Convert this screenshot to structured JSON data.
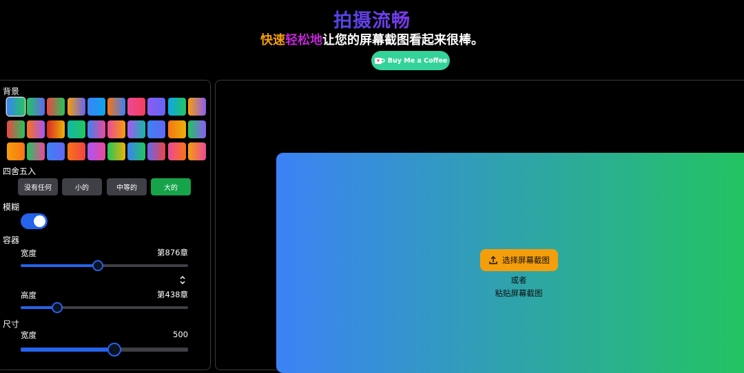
{
  "header": {
    "title": "拍摄流畅",
    "subtitle_a": "快速",
    "subtitle_b": "轻松地",
    "subtitle_c": "让您的屏幕截图看起来很棒。",
    "coffee_label": "Buy Me a Coffee"
  },
  "sidebar": {
    "background_label": "背景",
    "rounding_label": "四舍五入",
    "rounding_options": [
      "没有任何",
      "小的",
      "中等的",
      "大的"
    ],
    "rounding_selected": "大的",
    "blur_label": "模糊",
    "blur_on": true,
    "container_label": "容器",
    "container_width_label": "宽度",
    "container_width_value": "第876章",
    "container_width_fraction": 0.46,
    "container_height_label": "高度",
    "container_height_value": "第438章",
    "container_height_fraction": 0.22,
    "size_label": "尺寸",
    "size_width_label": "宽度",
    "size_width_value": "500",
    "size_width_fraction": 0.56
  },
  "backgrounds": [
    [
      "#3b82f6",
      "#22c55e"
    ],
    [
      "#22c55e",
      "#6366f1"
    ],
    [
      "#ef4444",
      "#22c55e"
    ],
    [
      "#f59e0b",
      "#6366f1"
    ],
    [
      "#3b82f6",
      "#0ea5e9"
    ],
    [
      "#f97316",
      "#3b82f6"
    ],
    [
      "#ec4899",
      "#f43f5e"
    ],
    [
      "#8b5cf6",
      "#6366f1"
    ],
    [
      "#0ea5e9",
      "#22c55e"
    ],
    [
      "#f59e0b",
      "#8b5cf6"
    ],
    [
      "#ef4444",
      "#22c55e"
    ],
    [
      "#f97316",
      "#a855f7"
    ],
    [
      "#dc2626",
      "#eab308"
    ],
    [
      "#14b8a6",
      "#22c55e"
    ],
    [
      "#3b82f6",
      "#ec4899"
    ],
    [
      "#ec4899",
      "#f59e0b"
    ],
    [
      "#a855f7",
      "#14b8a6"
    ],
    [
      "#3b82f6",
      "#6366f1"
    ],
    [
      "#f97316",
      "#eab308"
    ],
    [
      "#22c55e",
      "#8b5cf6"
    ],
    [
      "#f59e0b",
      "#f97316"
    ],
    [
      "#22c55e",
      "#ec4899"
    ],
    [
      "#3b82f6",
      "#6366f1"
    ],
    [
      "#f97316",
      "#ef4444"
    ],
    [
      "#a855f7",
      "#ec4899"
    ],
    [
      "#22c55e",
      "#eab308"
    ],
    [
      "#3b82f6",
      "#22c55e"
    ],
    [
      "#6366f1",
      "#ef4444"
    ],
    [
      "#ec4899",
      "#f97316"
    ],
    [
      "#f59e0b",
      "#ec4899"
    ]
  ],
  "canvas": {
    "upload_label": "选择屏幕截图",
    "or_label": "或者",
    "paste_label": "粘贴屏幕截图"
  },
  "icons": {
    "coffee": "coffee-cup-icon",
    "upload": "upload-icon",
    "chevron": "chevron-updown-icon"
  },
  "colors": {
    "accent": "#2563eb",
    "success": "#16a34a",
    "warning": "#f59e0b"
  }
}
